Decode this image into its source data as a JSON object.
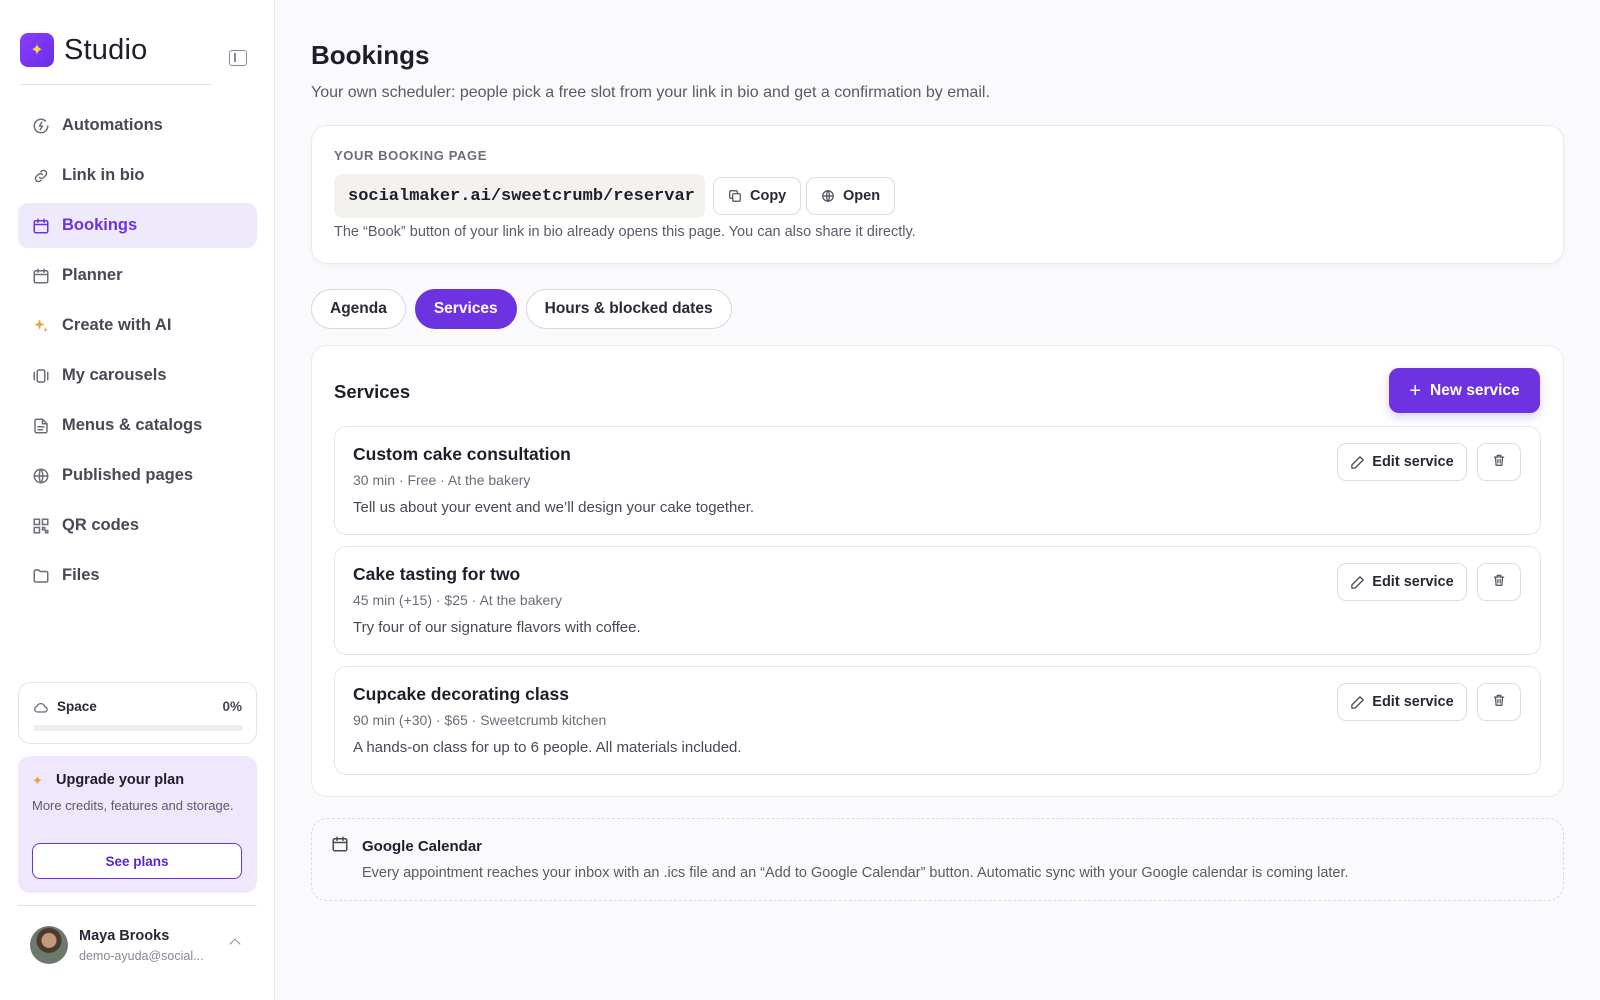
{
  "brand": {
    "name": "Studio"
  },
  "sidebar": {
    "items": [
      {
        "label": "Automations",
        "icon": "automation-icon"
      },
      {
        "label": "Link in bio",
        "icon": "link-icon"
      },
      {
        "label": "Bookings",
        "icon": "calendar-icon",
        "active": true
      },
      {
        "label": "Planner",
        "icon": "calendar-icon"
      },
      {
        "label": "Create with AI",
        "icon": "sparkle-icon"
      },
      {
        "label": "My carousels",
        "icon": "carousel-icon"
      },
      {
        "label": "Menus & catalogs",
        "icon": "document-icon"
      },
      {
        "label": "Published pages",
        "icon": "globe-icon"
      },
      {
        "label": "QR codes",
        "icon": "qr-code-icon"
      },
      {
        "label": "Files",
        "icon": "folder-icon"
      }
    ],
    "space": {
      "label": "Space",
      "percent_text": "0%",
      "usage": 0
    },
    "upgrade": {
      "title": "Upgrade your plan",
      "description": "More credits, features and storage.",
      "button_label": "See plans"
    },
    "user": {
      "name": "Maya Brooks",
      "email": "demo-ayuda@social..."
    }
  },
  "page": {
    "title": "Bookings",
    "subtitle": "Your own scheduler: people pick a free slot from your link in bio and get a confirmation by email."
  },
  "booking_page": {
    "eyebrow": "YOUR BOOKING PAGE",
    "url": "socialmaker.ai/sweetcrumb/reservar",
    "copy_label": "Copy",
    "open_label": "Open",
    "note": "The “Book” button of your link in bio already opens this page. You can also share it directly."
  },
  "tabs": [
    {
      "label": "Agenda",
      "active": false
    },
    {
      "label": "Services",
      "active": true
    },
    {
      "label": "Hours & blocked dates",
      "active": false
    }
  ],
  "services": {
    "title": "Services",
    "new_button_label": "New service",
    "edit_label": "Edit service",
    "items": [
      {
        "name": "Custom cake consultation",
        "meta": "30 min · Free · At the bakery",
        "description": "Tell us about your event and we’ll design your cake together."
      },
      {
        "name": "Cake tasting for two",
        "meta": "45 min (+15) · $25 · At the bakery",
        "description": "Try four of our signature flavors with coffee."
      },
      {
        "name": "Cupcake decorating class",
        "meta": "90 min (+30) · $65 · Sweetcrumb kitchen",
        "description": "A hands-on class for up to 6 people. All materials included."
      }
    ]
  },
  "google_calendar": {
    "title": "Google Calendar",
    "description": "Every appointment reaches your inbox with an .ics file and an “Add to Google Calendar” button. Automatic sync with your Google calendar is coming later."
  },
  "colors": {
    "accent": "#6d33e0",
    "accent_soft": "#efe9fc",
    "upgrade_bg": "#efe8fc"
  }
}
